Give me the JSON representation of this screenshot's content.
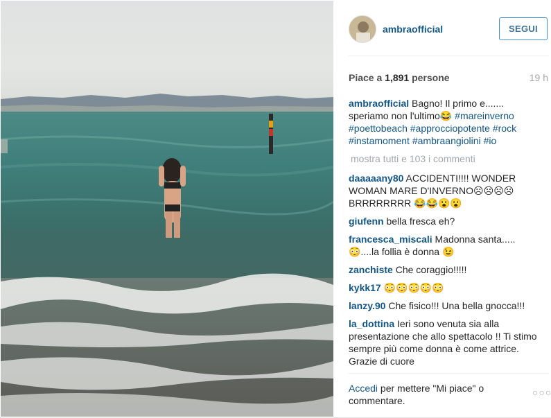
{
  "post": {
    "username": "ambraofficial",
    "follow_label": "SEGUI",
    "likes_prefix": "Piace a ",
    "likes_count": "1,891",
    "likes_suffix": " persone",
    "time": "19 h",
    "caption_text": "Bagno! Il primo e....... speriamo non l'ultimo😂 ",
    "caption_tags": [
      "#mareinverno",
      "#poettobeach",
      "#approcciopotente",
      "#rock",
      "#instamoment",
      "#ambraangiolini",
      "#io"
    ],
    "show_all_label": "mostra tutti e 103 i commenti",
    "comments": [
      {
        "user": "daaaaany80",
        "text": "ACCIDENTI!!!! WONDER WOMAN MARE D'INVERNO☹☹☹☹BRRRRRRRR 😂😂😮😮"
      },
      {
        "user": "giufenn",
        "text": "bella fresca eh?"
      },
      {
        "user": "francesca_miscali",
        "text": "Madonna santa.....😳....la follia è donna 😉"
      },
      {
        "user": "zanchiste",
        "text": "Che coraggio!!!!!"
      },
      {
        "user": "kykk17",
        "text": "😳😳😳😳😳"
      },
      {
        "user": "lanzy.90",
        "text": "Che fisico!!! Una bella gnocca!!!"
      },
      {
        "user": "la_dottina",
        "text": "Ieri sono venuta sia alla presentazione che allo spettacolo !! Ti stimo sempre più come donna è come attrice. Grazie di cuore"
      }
    ],
    "footer_link": "Accedi",
    "footer_text": " per mettere \"Mi piace\" o commentare.",
    "more_icon": "ellipsis-icon"
  }
}
